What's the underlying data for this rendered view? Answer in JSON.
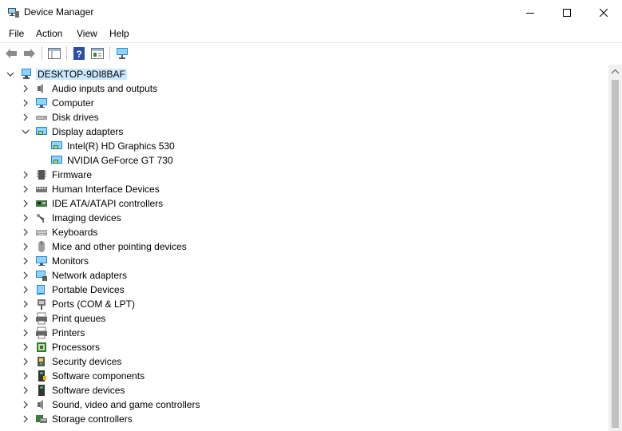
{
  "window": {
    "title": "Device Manager"
  },
  "menu": [
    "File",
    "Action",
    "View",
    "Help"
  ],
  "tree": {
    "root": "DESKTOP-9DI8BAF",
    "items": [
      {
        "label": "Audio inputs and outputs",
        "icon": "speaker-icon",
        "expanded": false
      },
      {
        "label": "Computer",
        "icon": "computer-icon",
        "expanded": false
      },
      {
        "label": "Disk drives",
        "icon": "disk-drive-icon",
        "expanded": false
      },
      {
        "label": "Display adapters",
        "icon": "display-adapter-icon",
        "expanded": true,
        "children": [
          {
            "label": "Intel(R) HD Graphics 530",
            "icon": "display-adapter-icon"
          },
          {
            "label": "NVIDIA GeForce GT 730",
            "icon": "display-adapter-icon"
          }
        ]
      },
      {
        "label": "Firmware",
        "icon": "firmware-icon",
        "expanded": false
      },
      {
        "label": "Human Interface Devices",
        "icon": "hid-icon",
        "expanded": false
      },
      {
        "label": "IDE ATA/ATAPI controllers",
        "icon": "ide-controller-icon",
        "expanded": false
      },
      {
        "label": "Imaging devices",
        "icon": "camera-icon",
        "expanded": false
      },
      {
        "label": "Keyboards",
        "icon": "keyboard-icon",
        "expanded": false
      },
      {
        "label": "Mice and other pointing devices",
        "icon": "mouse-icon",
        "expanded": false
      },
      {
        "label": "Monitors",
        "icon": "monitor-icon",
        "expanded": false
      },
      {
        "label": "Network adapters",
        "icon": "network-adapter-icon",
        "expanded": false
      },
      {
        "label": "Portable Devices",
        "icon": "portable-device-icon",
        "expanded": false
      },
      {
        "label": "Ports (COM & LPT)",
        "icon": "port-icon",
        "expanded": false
      },
      {
        "label": "Print queues",
        "icon": "print-queue-icon",
        "expanded": false
      },
      {
        "label": "Printers",
        "icon": "printer-icon",
        "expanded": false
      },
      {
        "label": "Processors",
        "icon": "processor-icon",
        "expanded": false
      },
      {
        "label": "Security devices",
        "icon": "security-device-icon",
        "expanded": false
      },
      {
        "label": "Software components",
        "icon": "software-component-icon",
        "expanded": false
      },
      {
        "label": "Software devices",
        "icon": "software-device-icon",
        "expanded": false
      },
      {
        "label": "Sound, video and game controllers",
        "icon": "sound-icon",
        "expanded": false
      },
      {
        "label": "Storage controllers",
        "icon": "storage-controller-icon",
        "expanded": false
      }
    ]
  },
  "colors": {
    "root_highlight": "#cce8ff",
    "icon_blue": "#1e88e5"
  }
}
